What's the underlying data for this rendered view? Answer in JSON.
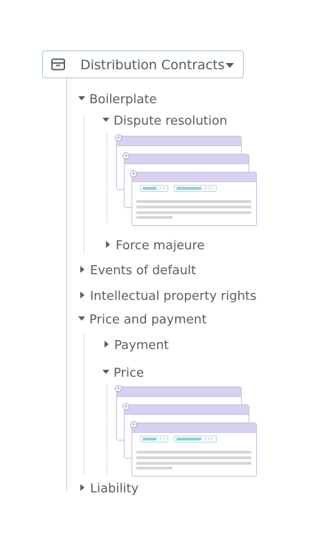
{
  "root": {
    "title": "Distribution Contracts",
    "icon": "archive-box-icon",
    "dropdown": "chevron-down-icon"
  },
  "tree": {
    "boilerplate": "Boilerplate",
    "dispute_resolution": "Dispute resolution",
    "force_majeure": "Force majeure",
    "events_of_default": "Events of default",
    "ip_rights": "Intellectual property rights",
    "price_and_payment": "Price and payment",
    "payment": "Payment",
    "price": "Price",
    "liability": "Liability"
  },
  "colors": {
    "accent_line": "#b7d3dc",
    "card_header": "#d8d0f0",
    "text": "#5a5f63"
  }
}
